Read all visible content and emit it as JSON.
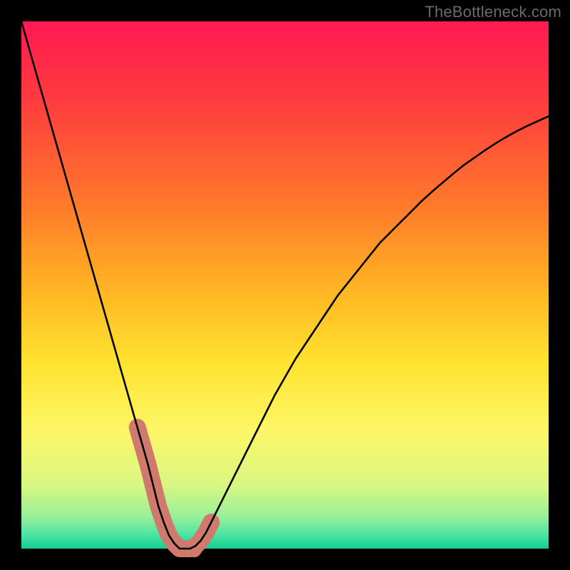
{
  "watermark": {
    "text": "TheBottleneck.com"
  },
  "chart_data": {
    "type": "line",
    "title": "",
    "xlabel": "",
    "ylabel": "",
    "xlim": [
      0,
      100
    ],
    "ylim": [
      0,
      100
    ],
    "x": [
      0,
      2,
      4,
      6,
      8,
      10,
      12,
      14,
      16,
      18,
      20,
      22,
      24,
      25,
      26,
      27,
      28,
      29,
      30,
      31,
      32,
      33,
      34,
      35,
      36,
      38,
      40,
      42,
      44,
      46,
      48,
      50,
      52,
      54,
      56,
      58,
      60,
      62,
      64,
      66,
      68,
      70,
      72,
      74,
      76,
      78,
      80,
      82,
      84,
      86,
      88,
      90,
      92,
      94,
      96,
      98,
      100
    ],
    "y": [
      100,
      93,
      86,
      79,
      72,
      65,
      58,
      51,
      44,
      37,
      30,
      23,
      16,
      12,
      8,
      5,
      2.5,
      1,
      0,
      0,
      0,
      0.5,
      1.5,
      3,
      5,
      9,
      13,
      17,
      21,
      25,
      29,
      32.5,
      36,
      39,
      42,
      45,
      48,
      50.5,
      53,
      55.5,
      58,
      60,
      62,
      64,
      66,
      67.8,
      69.5,
      71.2,
      72.8,
      74.2,
      75.6,
      76.9,
      78.1,
      79.2,
      80.2,
      81.1,
      82
    ],
    "min_region": {
      "start_x": 22,
      "end_x": 36
    },
    "gradient_stops": [
      {
        "pos": 0.0,
        "color": "#ff1a52"
      },
      {
        "pos": 0.15,
        "color": "#ff3c3f"
      },
      {
        "pos": 0.35,
        "color": "#ff7a2b"
      },
      {
        "pos": 0.5,
        "color": "#ffb223"
      },
      {
        "pos": 0.65,
        "color": "#ffe431"
      },
      {
        "pos": 0.78,
        "color": "#fdf769"
      },
      {
        "pos": 0.88,
        "color": "#d8f783"
      },
      {
        "pos": 0.94,
        "color": "#98f09a"
      },
      {
        "pos": 0.975,
        "color": "#4be3a4"
      },
      {
        "pos": 1.0,
        "color": "#11d08e"
      }
    ],
    "marker_color": "#cf7a6d",
    "curve_color": "#000000",
    "curve_width": 2.6
  }
}
